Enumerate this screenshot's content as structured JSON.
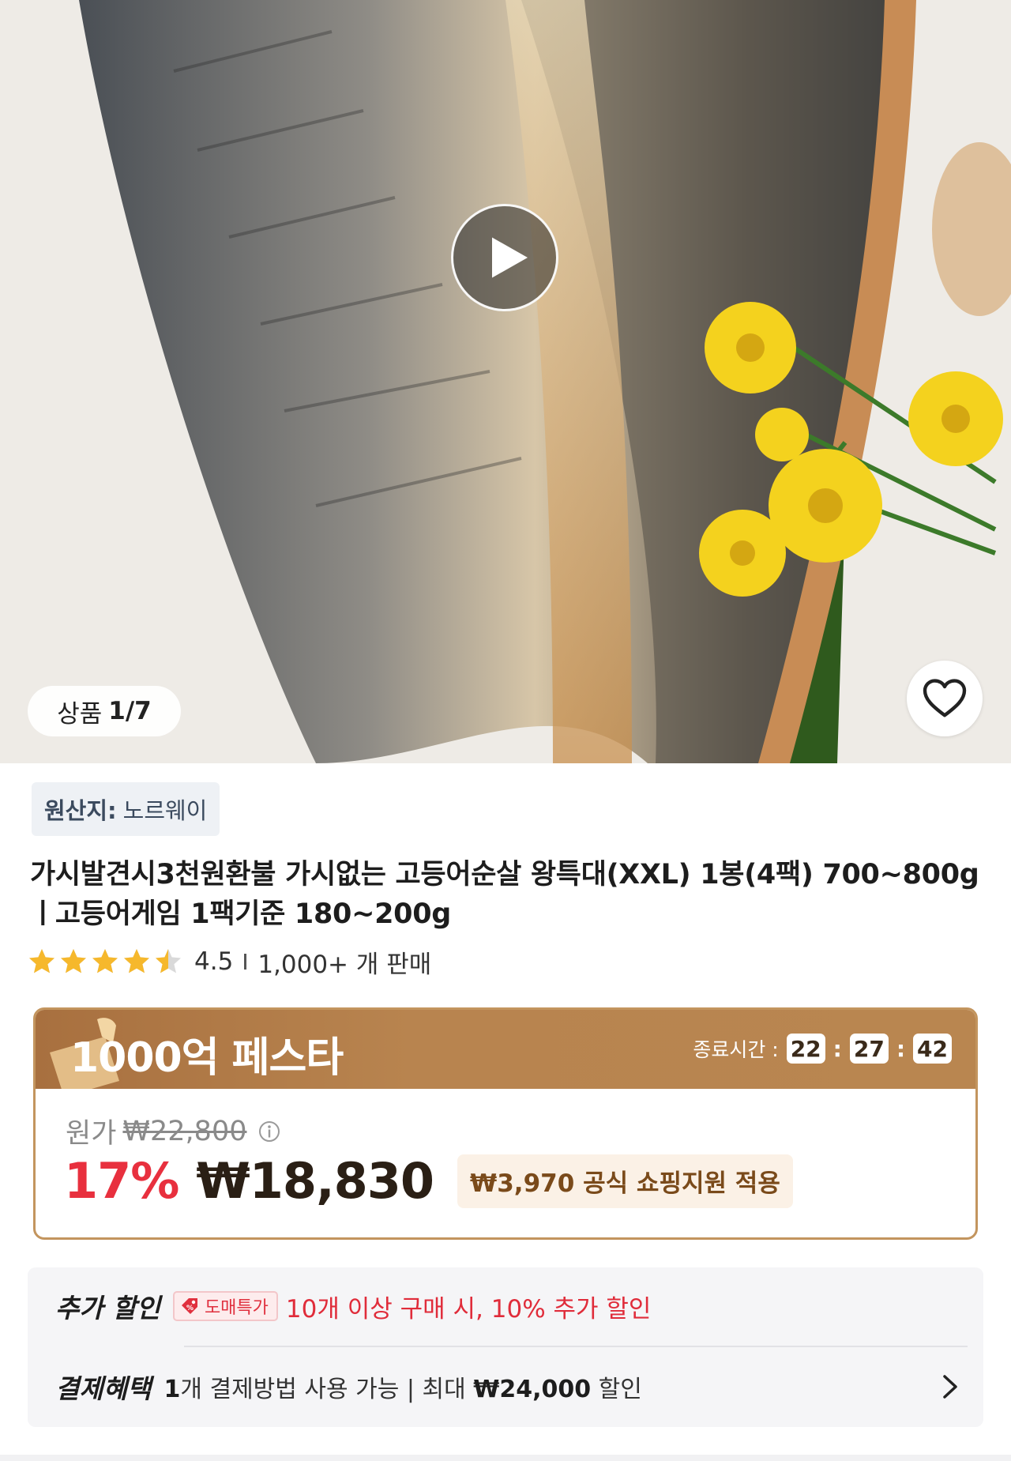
{
  "gallery": {
    "counter_label": "상품",
    "counter_value": "1/7"
  },
  "origin": {
    "key": "원산지:",
    "value": "노르웨이"
  },
  "product": {
    "title": "가시발견시3천원환불 가시없는 고등어순살 왕특대(XXL) 1봉(4팩) 700~800g ㅣ고등어게임 1팩기준 180~200g",
    "rating": 4.5,
    "rating_text": "4.5",
    "sold_text": "1,000+ 개 판매"
  },
  "promo": {
    "title": "1000억 페스타",
    "timer_label": "종료시간 :",
    "timer": [
      "22",
      "27",
      "42"
    ],
    "original_label": "원가",
    "original_price": "₩22,800",
    "discount_pct": "17%",
    "sale_price": "₩18,830",
    "support_text": "₩3,970 공식 쇼핑지원 적용"
  },
  "benefits": {
    "extra_label": "추가 할인",
    "wholesale_tag": "도매특가",
    "extra_text": "10개 이상 구매 시, 10% 추가 할인",
    "payment_label": "결제혜택",
    "payment_count": "1",
    "payment_text_mid": "개 결제방법 사용 가능 | 최대 ",
    "payment_amount": "₩24,000",
    "payment_text_end": " 할인"
  },
  "colors": {
    "accent_red": "#e8303e",
    "promo_brown": "#b98650",
    "star_yellow": "#f6b82c"
  },
  "icons": [
    "play-icon",
    "heart-icon",
    "star-icon",
    "info-icon",
    "tag-icon",
    "chevron-right-icon"
  ]
}
